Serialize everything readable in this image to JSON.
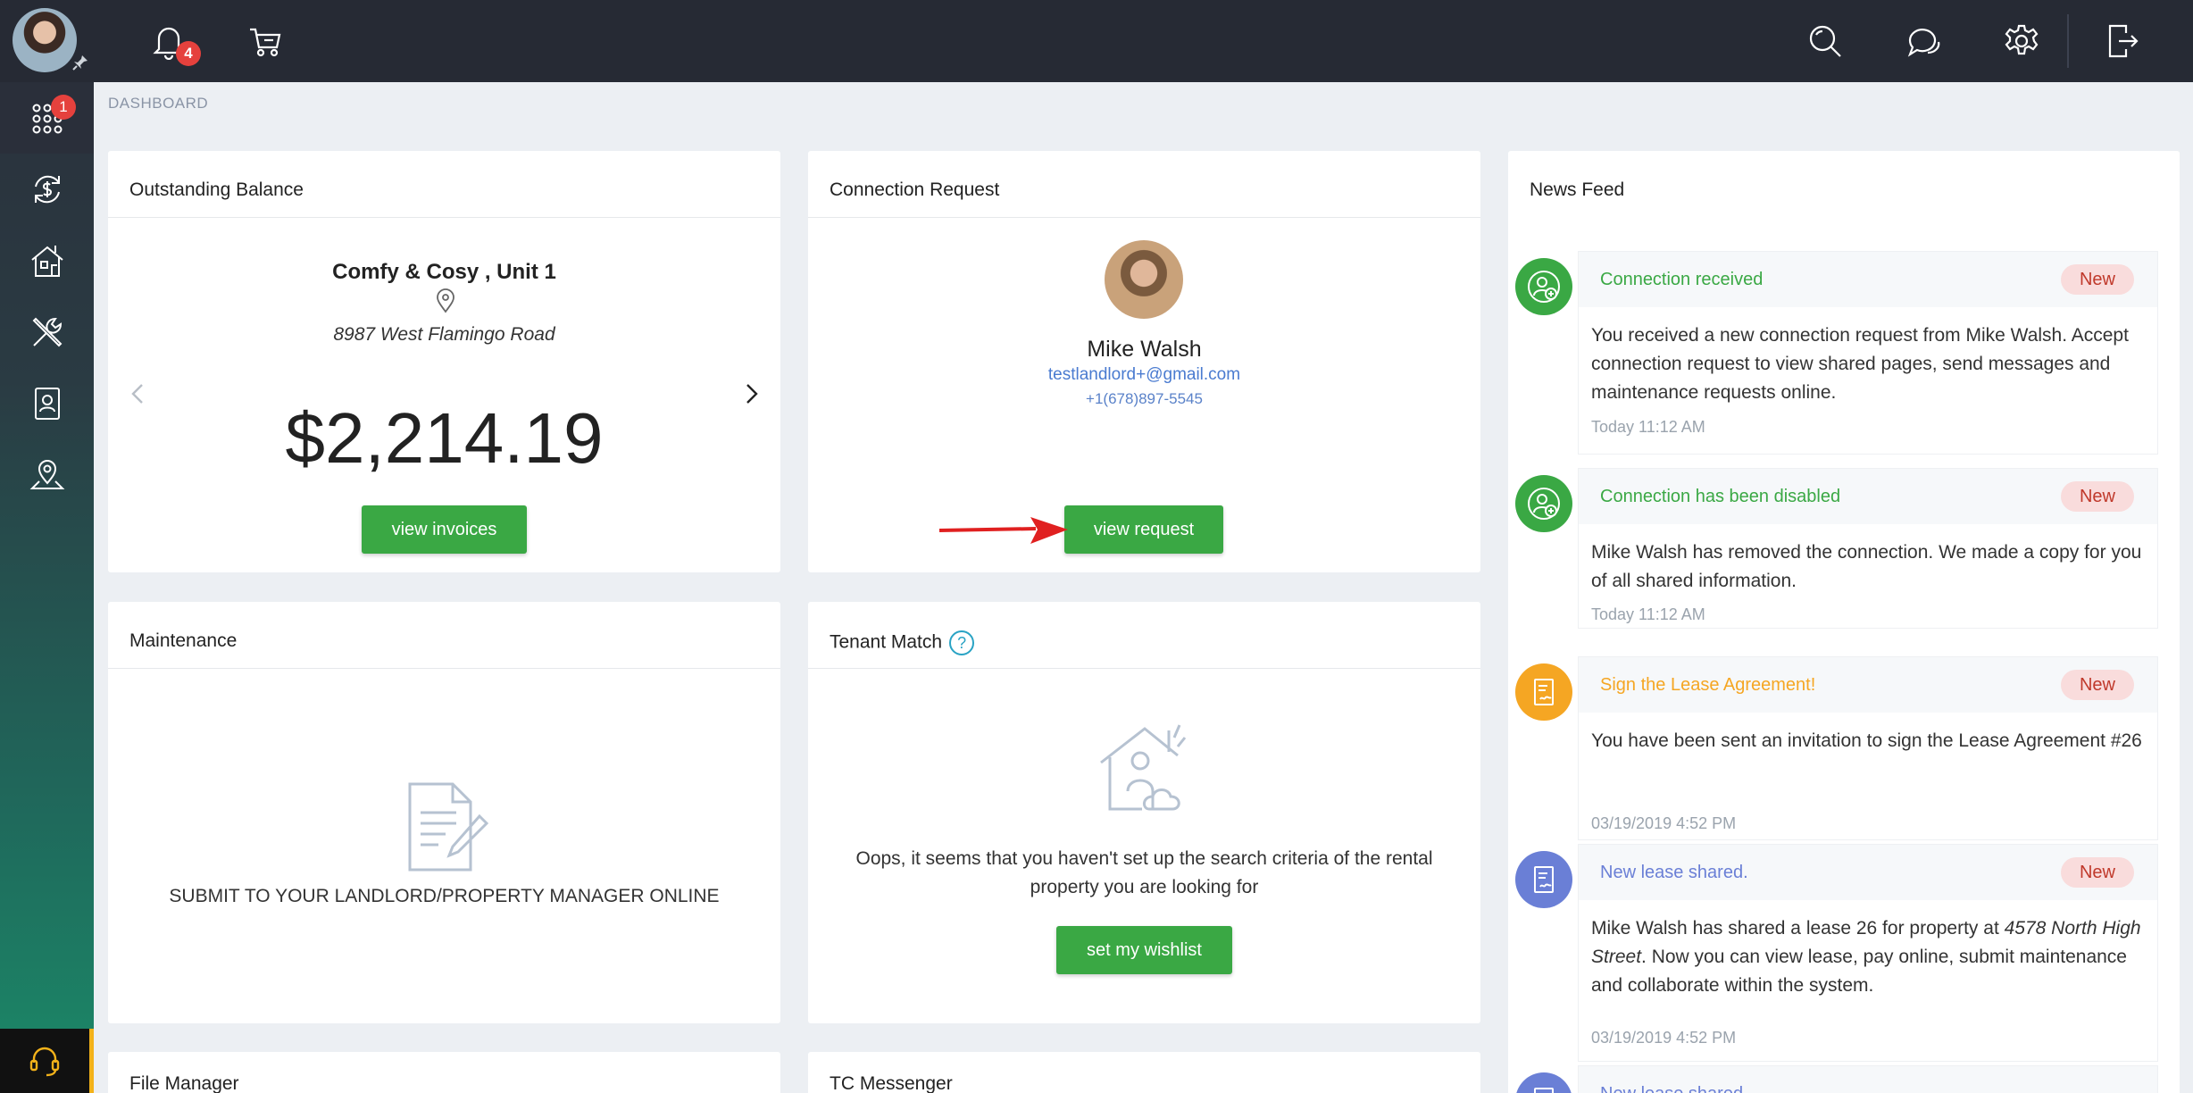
{
  "sidebar": {
    "apps_badge": "1",
    "items": [
      {
        "name": "apps",
        "icon": "grid-icon"
      },
      {
        "name": "payments",
        "icon": "money-cycle-icon"
      },
      {
        "name": "properties",
        "icon": "house-icon"
      },
      {
        "name": "maintenance",
        "icon": "tools-icon"
      },
      {
        "name": "documents",
        "icon": "person-document-icon"
      },
      {
        "name": "location",
        "icon": "map-pin-icon"
      }
    ]
  },
  "topbar": {
    "notifications_badge": "4"
  },
  "breadcrumb": "DASHBOARD",
  "outstanding": {
    "title": "Outstanding Balance",
    "property": "Comfy & Cosy , Unit 1",
    "address": "8987 West Flamingo Road",
    "amount": "$2,214.19",
    "button": "view invoices"
  },
  "connection": {
    "title": "Connection Request",
    "name": "Mike Walsh",
    "email": "testlandlord+@gmail.com",
    "phone": "+1(678)897-5545",
    "button": "view request"
  },
  "maintenance": {
    "title": "Maintenance",
    "text": "SUBMIT TO YOUR LANDLORD/PROPERTY MANAGER ONLINE"
  },
  "tenant_match": {
    "title": "Tenant Match",
    "help": "?",
    "text": "Oops, it seems that you haven't set up the search criteria of the rental property you are looking for",
    "button": "set my wishlist"
  },
  "file_manager": {
    "title": "File Manager"
  },
  "tc_messenger": {
    "title": "TC Messenger"
  },
  "news_feed": {
    "title": "News Feed",
    "items": [
      {
        "heading": "Connection received",
        "badge": "New",
        "body": "You received a new connection request from Mike Walsh. Accept connection request to view shared pages, send messages and maintenance requests online.",
        "time": "Today 11:12 AM",
        "color": "#3aa844"
      },
      {
        "heading": "Connection has been disabled",
        "badge": "New",
        "body": "Mike Walsh has removed the connection. We made a copy for you of all shared information.",
        "time": "Today 11:12 AM",
        "color": "#3aa844"
      },
      {
        "heading": "Sign the Lease Agreement!",
        "badge": "New",
        "body": "You have been sent an invitation to sign the Lease Agreement #26",
        "time": "03/19/2019 4:52 PM",
        "color": "#f5a623"
      },
      {
        "heading": "New lease shared.",
        "badge": "New",
        "body_prefix": "Mike Walsh has shared a lease 26 for property at ",
        "body_address": "4578 North High Street",
        "body_suffix": ". Now you can view lease, pay online, submit maintenance and collaborate within the system.",
        "time": "03/19/2019 4:52 PM",
        "color": "#6a7fd6"
      },
      {
        "heading": "New lease shared.",
        "color": "#6a7fd6"
      }
    ]
  }
}
